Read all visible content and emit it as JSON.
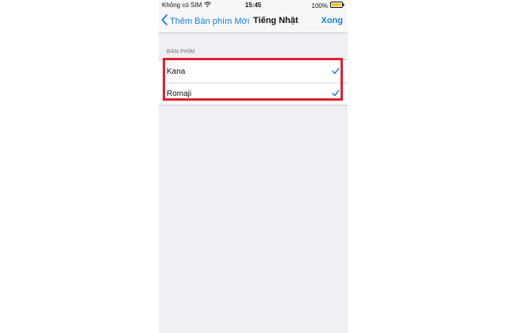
{
  "status_bar": {
    "carrier": "Không có SIM",
    "time": "15:45",
    "battery_percent": "100%",
    "wifi_icon": "wifi-icon",
    "battery_icon": "battery-icon"
  },
  "nav": {
    "back_label": "Thêm Bàn phím Mới",
    "title": "Tiếng Nhật",
    "done_label": "Xong"
  },
  "section": {
    "header": "BÀN PHÍM",
    "items": [
      {
        "label": "Kana",
        "checked": true
      },
      {
        "label": "Romaji",
        "checked": true
      }
    ]
  },
  "colors": {
    "accent": "#1a7ee0",
    "highlight": "#e1202f",
    "background": "#efeff4",
    "battery": "#f4c430"
  }
}
